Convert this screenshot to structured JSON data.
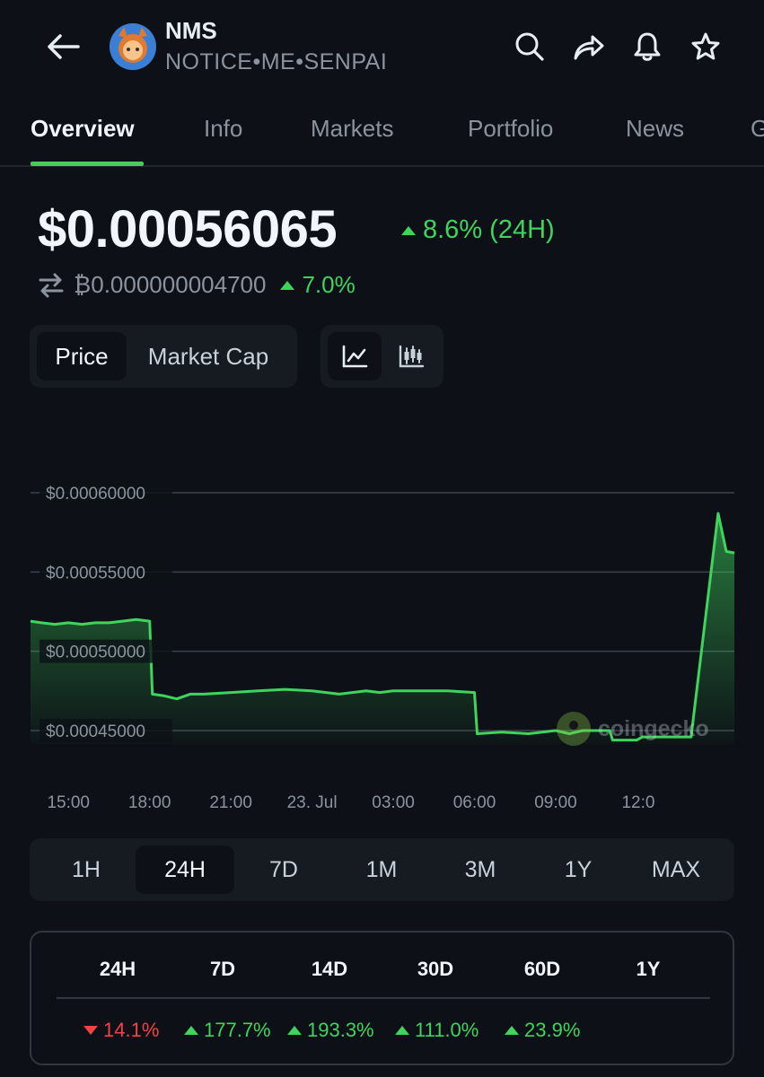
{
  "header": {
    "symbol": "NMS",
    "name": "NOTICE•ME•SENPAI",
    "icons": [
      "back-arrow-icon",
      "search-icon",
      "share-icon",
      "bell-icon",
      "star-icon"
    ]
  },
  "tabs": [
    "Overview",
    "Info",
    "Markets",
    "Portfolio",
    "News",
    "G"
  ],
  "price": {
    "usd": "$0.00056065",
    "change_24h": "8.6% (24H)",
    "btc": "₿0.000000004700",
    "btc_change": "7.0%"
  },
  "toggles": {
    "price_label": "Price",
    "market_cap_label": "Market Cap",
    "chart_types": [
      "line-chart-icon",
      "candlestick-icon"
    ]
  },
  "chart_data": {
    "type": "area",
    "y_ticks": [
      "$0.00060000",
      "$0.00055000",
      "$0.00050000",
      "$0.00045000"
    ],
    "ylim": [
      0.00045,
      0.0006
    ],
    "x_ticks": [
      "15:00",
      "18:00",
      "21:00",
      "23. Jul",
      "03:00",
      "06:00",
      "09:00",
      "12:0"
    ],
    "x": [
      13.6,
      14,
      14.5,
      15,
      15.5,
      16,
      16.5,
      17,
      17.5,
      18,
      18.1,
      18.5,
      19,
      19.5,
      20,
      21,
      22,
      23,
      24,
      25,
      26,
      26.5,
      27,
      28,
      29,
      30,
      30.1,
      31,
      32,
      33,
      33.5,
      34,
      35,
      35.1,
      36,
      36.2,
      37,
      38,
      39,
      39.3,
      39.6
    ],
    "values": [
      0.000519,
      0.000518,
      0.000517,
      0.000518,
      0.000517,
      0.000518,
      0.000518,
      0.000519,
      0.00052,
      0.000519,
      0.000473,
      0.000472,
      0.00047,
      0.000473,
      0.000473,
      0.000474,
      0.000475,
      0.000476,
      0.000475,
      0.000473,
      0.000475,
      0.000474,
      0.000475,
      0.000475,
      0.000475,
      0.000474,
      0.000448,
      0.000449,
      0.000448,
      0.00045,
      0.000448,
      0.00045,
      0.00045,
      0.000444,
      0.000444,
      0.000446,
      0.000446,
      0.000446,
      0.000587,
      0.000563,
      0.000562
    ],
    "watermark": "coingecko",
    "line_color": "#3fd45c",
    "grid": true
  },
  "ranges": [
    "1H",
    "24H",
    "7D",
    "1M",
    "3M",
    "1Y",
    "MAX"
  ],
  "active_range": "24H",
  "performance": {
    "periods": [
      "24H",
      "7D",
      "14D",
      "30D",
      "60D",
      "1Y"
    ],
    "changes": [
      {
        "value": "14.1%",
        "dir": "down"
      },
      {
        "value": "177.7%",
        "dir": "up"
      },
      {
        "value": "193.3%",
        "dir": "up"
      },
      {
        "value": "111.0%",
        "dir": "up"
      },
      {
        "value": "23.9%",
        "dir": "up"
      }
    ]
  },
  "colors": {
    "background": "#0d1117",
    "positive": "#3fd45c",
    "negative": "#f04444",
    "accent": "#4bcc5a"
  }
}
